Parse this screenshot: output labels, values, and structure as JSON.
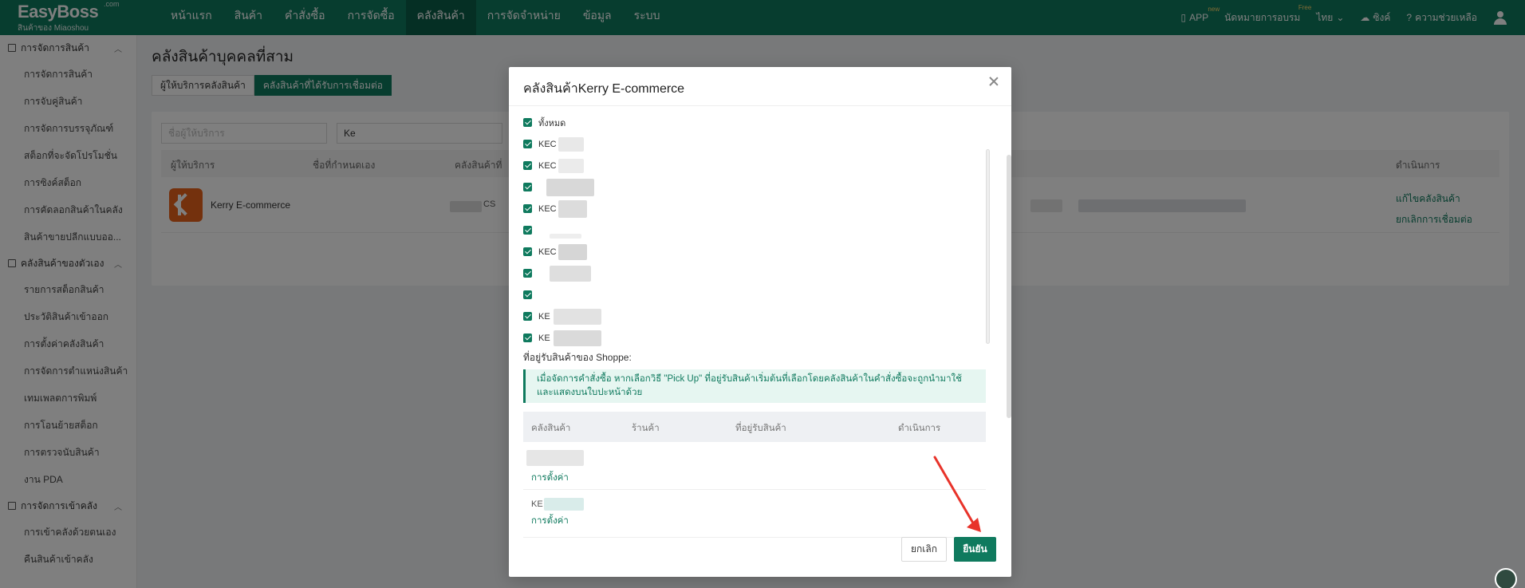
{
  "app": {
    "brand": "EasyBoss",
    "brand_sup": ".com",
    "tagline": "สินค้าของ Miaoshou"
  },
  "nav": [
    {
      "label": "หน้าแรก",
      "active": false
    },
    {
      "label": "สินค้า",
      "active": false
    },
    {
      "label": "คำสั่งซื้อ",
      "active": false
    },
    {
      "label": "การจัดซื้อ",
      "active": false
    },
    {
      "label": "คลังสินค้า",
      "active": true
    },
    {
      "label": "การจัดจำหน่าย",
      "active": false
    },
    {
      "label": "ข้อมูล",
      "active": false
    },
    {
      "label": "ระบบ",
      "active": false
    }
  ],
  "top_right": {
    "app_label": "APP",
    "app_sup": "new",
    "training": "นัดหมายการอบรม",
    "training_sup": "Free",
    "language": "ไทย",
    "sync": "ซิงค์",
    "help": "ความช่วยเหลือ"
  },
  "sidebar": {
    "groups": [
      {
        "label": "การจัดการสินค้า",
        "items": [
          "การจัดการสินค้า",
          "การจับคู่สินค้า",
          "การจัดการบรรจุภัณฑ์",
          "สต็อกที่จะจัดโปรโมชั่น",
          "การซิงค์สต็อก",
          "การคัดลอกสินค้าในคลัง",
          "สินค้าขายปลีกแบบออ..."
        ]
      },
      {
        "label": "คลังสินค้าของตัวเอง",
        "items": [
          "รายการสต็อกสินค้า",
          "ประวัติสินค้าเข้าออก",
          "การตั้งค่าคลังสินค้า",
          "การจัดการตำแหน่งสินค้า",
          "เทมเพลตการพิมพ์",
          "การโอนย้ายสต็อก",
          "การตรวจนับสินค้า",
          "งาน PDA"
        ]
      },
      {
        "label": "การจัดการเข้าคลัง",
        "items": [
          "การเข้าคลังด้วยตนเอง",
          "คืนสินค้าเข้าคลัง"
        ]
      }
    ]
  },
  "main": {
    "title": "คลังสินค้าบุคคลที่สาม",
    "tabs": [
      "ผู้ให้บริการคลังสินค้า",
      "คลังสินค้าที่ได้รับการเชื่อมต่อ"
    ],
    "filter_provider_placeholder": "ชื่อผู้ให้บริการ",
    "filter_value": "Ke",
    "columns": [
      "ผู้ให้บริการ",
      "ชื่อที่กำหนดเอง",
      "คลังสินค้าที่",
      "ดำเนินการ"
    ],
    "row": {
      "provider": "Kerry E-commerce",
      "code_fragment": "CS",
      "actions": [
        "แก้ไขคลังสินค้า",
        "ยกเลิกการเชื่อมต่อ"
      ]
    }
  },
  "modal": {
    "title": "คลังสินค้าKerry E-commerce",
    "select_all": "ทั้งหมด",
    "warehouses": [
      "KEC",
      "KEC",
      "",
      "KEC",
      "",
      "KEC",
      "",
      "",
      "KE",
      "KE"
    ],
    "pickup_label": "ที่อยู่รับสินค้าของ Shoppe:",
    "notice": "เมื่อจัดการคำสั่งซื้อ หากเลือกวิธี \"Pick Up\" ที่อยู่รับสินค้าเริ่มต้นที่เลือกโดยคลังสินค้าในคำสั่งซื้อจะถูกนำมาใช้และแสดงบนใบปะหน้าด้วย",
    "columns": [
      "คลังสินค้า",
      "ร้านค้า",
      "ที่อยู่รับสินค้า",
      "ดำเนินการ"
    ],
    "rows": [
      {
        "name": "",
        "link": "การตั้งค่า"
      },
      {
        "name": "KE",
        "link": "การตั้งค่า"
      }
    ],
    "cancel": "ยกเลิก",
    "confirm": "ยืนยัน"
  },
  "colors": {
    "primary": "#0f7a5e",
    "primary_dark": "#0b5e48",
    "annotation_arrow": "#e8332a"
  }
}
